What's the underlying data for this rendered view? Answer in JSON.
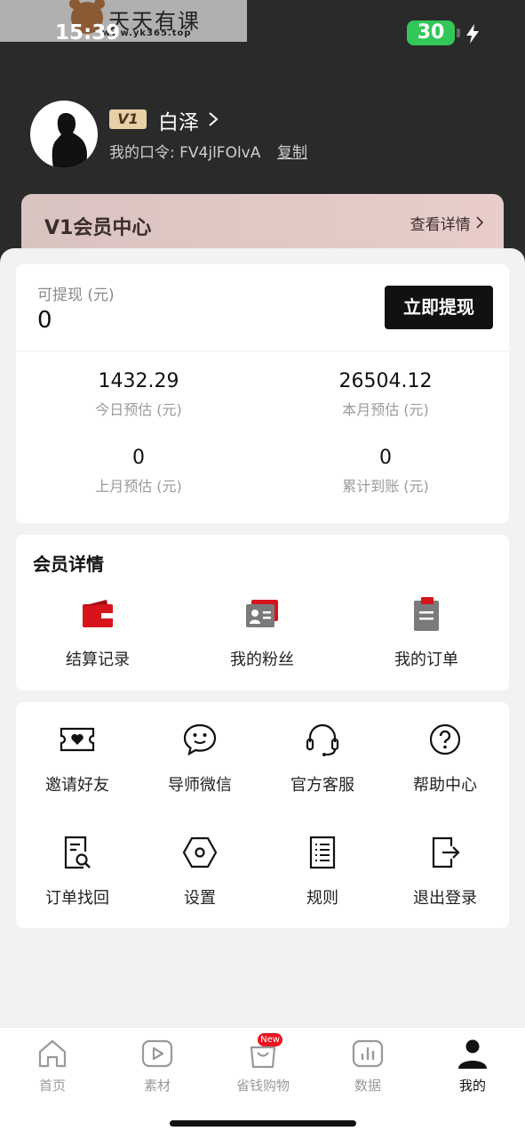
{
  "watermark": {
    "title": "天天有课",
    "url": "www.yk365.top"
  },
  "status_bar": {
    "time": "15:39",
    "battery": "30"
  },
  "profile": {
    "badge": "V1",
    "name": "白泽",
    "invite_code": "我的口令: FV4jlFOlvA",
    "copy_label": "复制"
  },
  "vip_card": {
    "title": "V1会员中心",
    "link": "查看详情"
  },
  "earnings": {
    "withdraw_label": "可提现 (元)",
    "withdraw_value": "0",
    "withdraw_button": "立即提现",
    "stats": [
      {
        "value": "1432.29",
        "label": "今日预估 (元)"
      },
      {
        "value": "26504.12",
        "label": "本月预估 (元)"
      },
      {
        "value": "0",
        "label": "上月预估 (元)"
      },
      {
        "value": "0",
        "label": "累计到账 (元)"
      }
    ]
  },
  "member": {
    "title": "会员详情",
    "items": [
      {
        "label": "结算记录",
        "icon": "wallet-icon"
      },
      {
        "label": "我的粉丝",
        "icon": "fans-card-icon"
      },
      {
        "label": "我的订单",
        "icon": "order-clipboard-icon"
      }
    ]
  },
  "grid": {
    "items": [
      {
        "label": "邀请好友",
        "icon": "ticket-heart-icon"
      },
      {
        "label": "导师微信",
        "icon": "chat-bubble-icon"
      },
      {
        "label": "官方客服",
        "icon": "headset-icon"
      },
      {
        "label": "帮助中心",
        "icon": "help-circle-icon"
      },
      {
        "label": "订单找回",
        "icon": "document-search-icon"
      },
      {
        "label": "设置",
        "icon": "settings-hexagon-icon"
      },
      {
        "label": "规则",
        "icon": "rules-list-icon"
      },
      {
        "label": "退出登录",
        "icon": "logout-icon"
      }
    ]
  },
  "tabbar": {
    "items": [
      {
        "label": "首页",
        "icon": "home-icon"
      },
      {
        "label": "素材",
        "icon": "play-icon"
      },
      {
        "label": "省钱购物",
        "icon": "shopping-bag-icon"
      },
      {
        "label": "数据",
        "icon": "bar-chart-icon"
      },
      {
        "label": "我的",
        "icon": "user-icon"
      }
    ],
    "badge": "New",
    "active": "我的"
  },
  "colors": {
    "accent_red": "#d7141c",
    "battery_green": "#33c759",
    "header_bg": "#2a2a2a",
    "vip_gold": "#e8cfa5"
  }
}
